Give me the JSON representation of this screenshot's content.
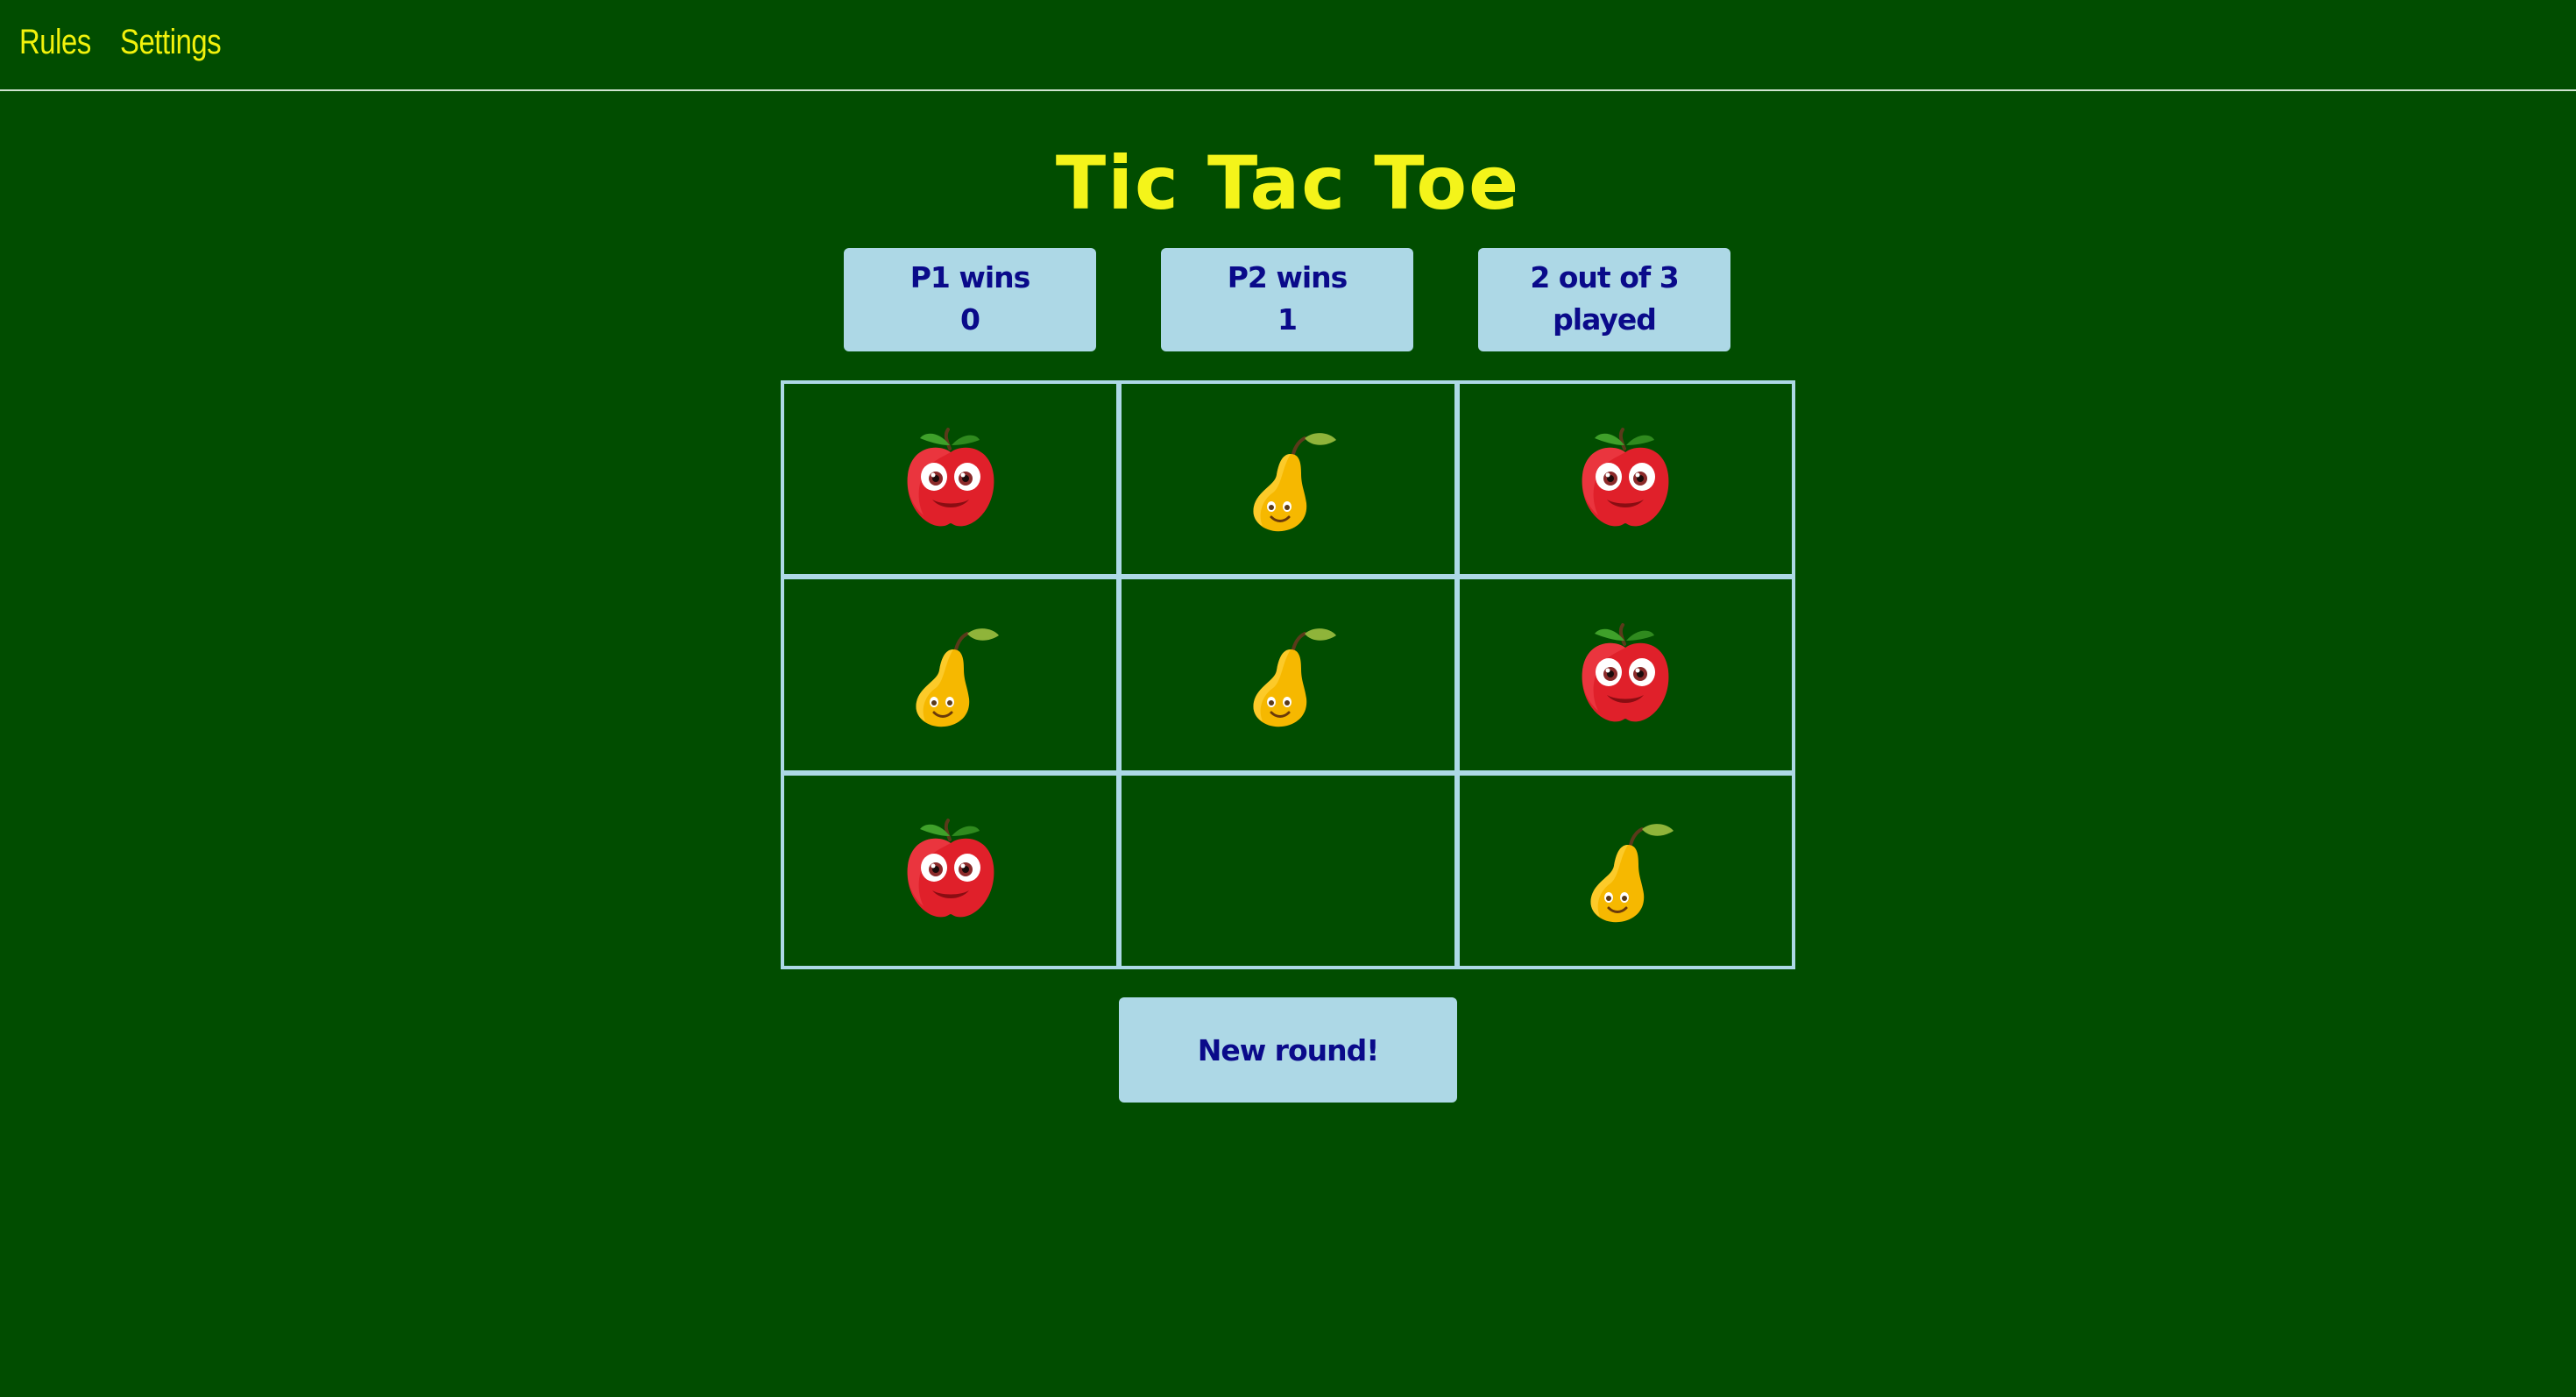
{
  "nav": {
    "rules_label": "Rules",
    "settings_label": "Settings"
  },
  "title": "Tic Tac Toe",
  "scores": {
    "p1": {
      "label": "P1 wins",
      "value": "0"
    },
    "p2": {
      "label": "P2 wins",
      "value": "1"
    },
    "rounds": {
      "line1": "2 out of 3",
      "line2": "played"
    }
  },
  "board": {
    "cells": [
      "apple",
      "pear",
      "apple",
      "pear",
      "pear",
      "apple",
      "apple",
      "",
      "pear"
    ]
  },
  "new_round_label": "New round!",
  "colors": {
    "background": "#014d00",
    "accent_yellow": "#f4f41a",
    "panel": "#add8e6",
    "panel_text": "#0a0a8a"
  }
}
